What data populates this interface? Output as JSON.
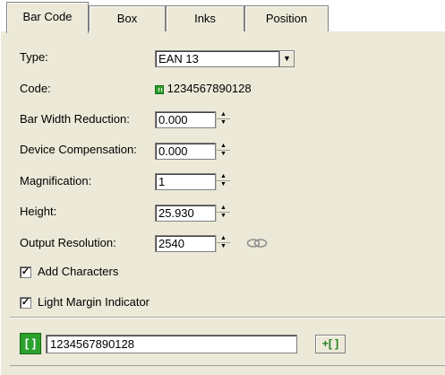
{
  "tabs": [
    {
      "label": "Bar Code",
      "active": true
    },
    {
      "label": "Box",
      "active": false
    },
    {
      "label": "Inks",
      "active": false
    },
    {
      "label": "Position",
      "active": false
    }
  ],
  "form": {
    "type": {
      "label": "Type:",
      "value": "EAN 13"
    },
    "code": {
      "label": "Code:",
      "value": "1234567890128"
    },
    "bar_width_reduction": {
      "label": "Bar Width Reduction:",
      "value": "0.000"
    },
    "device_compensation": {
      "label": "Device Compensation:",
      "value": "0.000"
    },
    "magnification": {
      "label": "Magnification:",
      "value": "1"
    },
    "height": {
      "label": "Height:",
      "value": "25.930"
    },
    "output_resolution": {
      "label": "Output Resolution:",
      "value": "2540"
    },
    "add_characters": {
      "label": "Add Characters",
      "checked": true
    },
    "light_margin_indicator": {
      "label": "Light Margin Indicator",
      "checked": true
    }
  },
  "bottom": {
    "code_value": "1234567890128",
    "barcode_button_glyph": "[ ]",
    "add_button_glyph": "+[ ]"
  },
  "icons": {
    "spin_up": "▲",
    "spin_down": "▼",
    "dropdown": "▼",
    "check": "✓",
    "link": "chain-link-icon"
  }
}
